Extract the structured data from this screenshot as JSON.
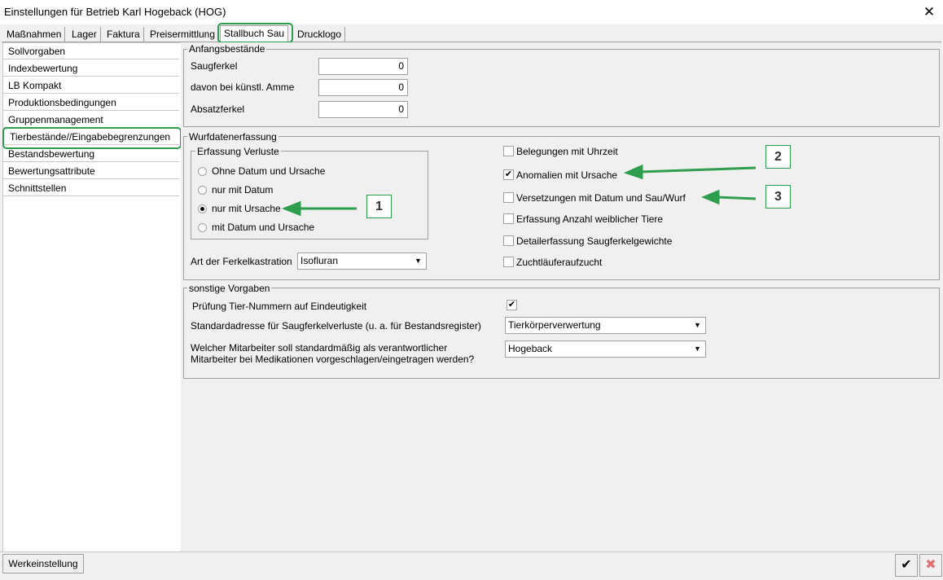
{
  "window": {
    "title": "Einstellungen für Betrieb Karl Hogeback (HOG)",
    "close_glyph": "✕"
  },
  "tabs": [
    {
      "label": "Maßnahmen"
    },
    {
      "label": "Lager"
    },
    {
      "label": "Faktura"
    },
    {
      "label": "Preisermittlung"
    },
    {
      "label": "Stallbuch Sau",
      "active": true
    },
    {
      "label": "Drucklogo"
    }
  ],
  "sidebar": {
    "items": [
      {
        "label": "Sollvorgaben"
      },
      {
        "label": "Indexbewertung"
      },
      {
        "label": "LB Kompakt"
      },
      {
        "label": "Produktionsbedingungen"
      },
      {
        "label": "Gruppenmanagement"
      },
      {
        "label": "Tierbestände//Eingabebegrenzungen",
        "selected": true
      },
      {
        "label": "Bestandsbewertung"
      },
      {
        "label": "Bewertungsattribute"
      },
      {
        "label": "Schnittstellen"
      }
    ]
  },
  "anfangsbestaende": {
    "title": "Anfangsbestände",
    "fields": [
      {
        "label": "Saugferkel",
        "value": "0"
      },
      {
        "label": "davon bei künstl. Amme",
        "value": "0"
      },
      {
        "label": "Absatzferkel",
        "value": "0"
      }
    ]
  },
  "wurfdaten": {
    "title": "Wurfdatenerfassung",
    "verluste": {
      "title": "Erfassung Verluste",
      "options": [
        {
          "label": "Ohne Datum und Ursache",
          "selected": false
        },
        {
          "label": "nur mit Datum",
          "selected": false
        },
        {
          "label": "nur mit Ursache",
          "selected": true
        },
        {
          "label": "mit Datum und Ursache",
          "selected": false
        }
      ]
    },
    "kastration": {
      "label": "Art der Ferkelkastration",
      "value": "Isofluran"
    },
    "checkboxes": [
      {
        "label": "Belegungen mit Uhrzeit",
        "checked": false
      },
      {
        "label": "Anomalien mit Ursache",
        "checked": true
      },
      {
        "label": "Versetzungen mit Datum und Sau/Wurf",
        "checked": false
      },
      {
        "label": "Erfassung Anzahl weiblicher Tiere",
        "checked": false
      },
      {
        "label": "Detailerfassung Saugferkelgewichte",
        "checked": false
      },
      {
        "label": "Zuchtläuferaufzucht",
        "checked": false
      }
    ]
  },
  "sonstige": {
    "title": "sonstige Vorgaben",
    "pruefung": {
      "label": "Prüfung Tier-Nummern auf Eindeutigkeit",
      "checked": true
    },
    "standardadresse": {
      "label": "Standardadresse für Saugferkelverluste (u. a. für Bestandsregister)",
      "value": "Tierkörperverwertung"
    },
    "mitarbeiter": {
      "label_line1": "Welcher Mitarbeiter soll standardmäßig als verantwortlicher",
      "label_line2": "Mitarbeiter bei Medikationen vorgeschlagen/eingetragen werden?",
      "value": "Hogeback"
    }
  },
  "callouts": [
    "1",
    "2",
    "3"
  ],
  "footer": {
    "reset_label": "Werkeinstellung",
    "ok_glyph": "✔",
    "cancel_glyph": "✖"
  },
  "colors": {
    "highlight": "#2e9e4e",
    "cancel": "#e07070"
  }
}
